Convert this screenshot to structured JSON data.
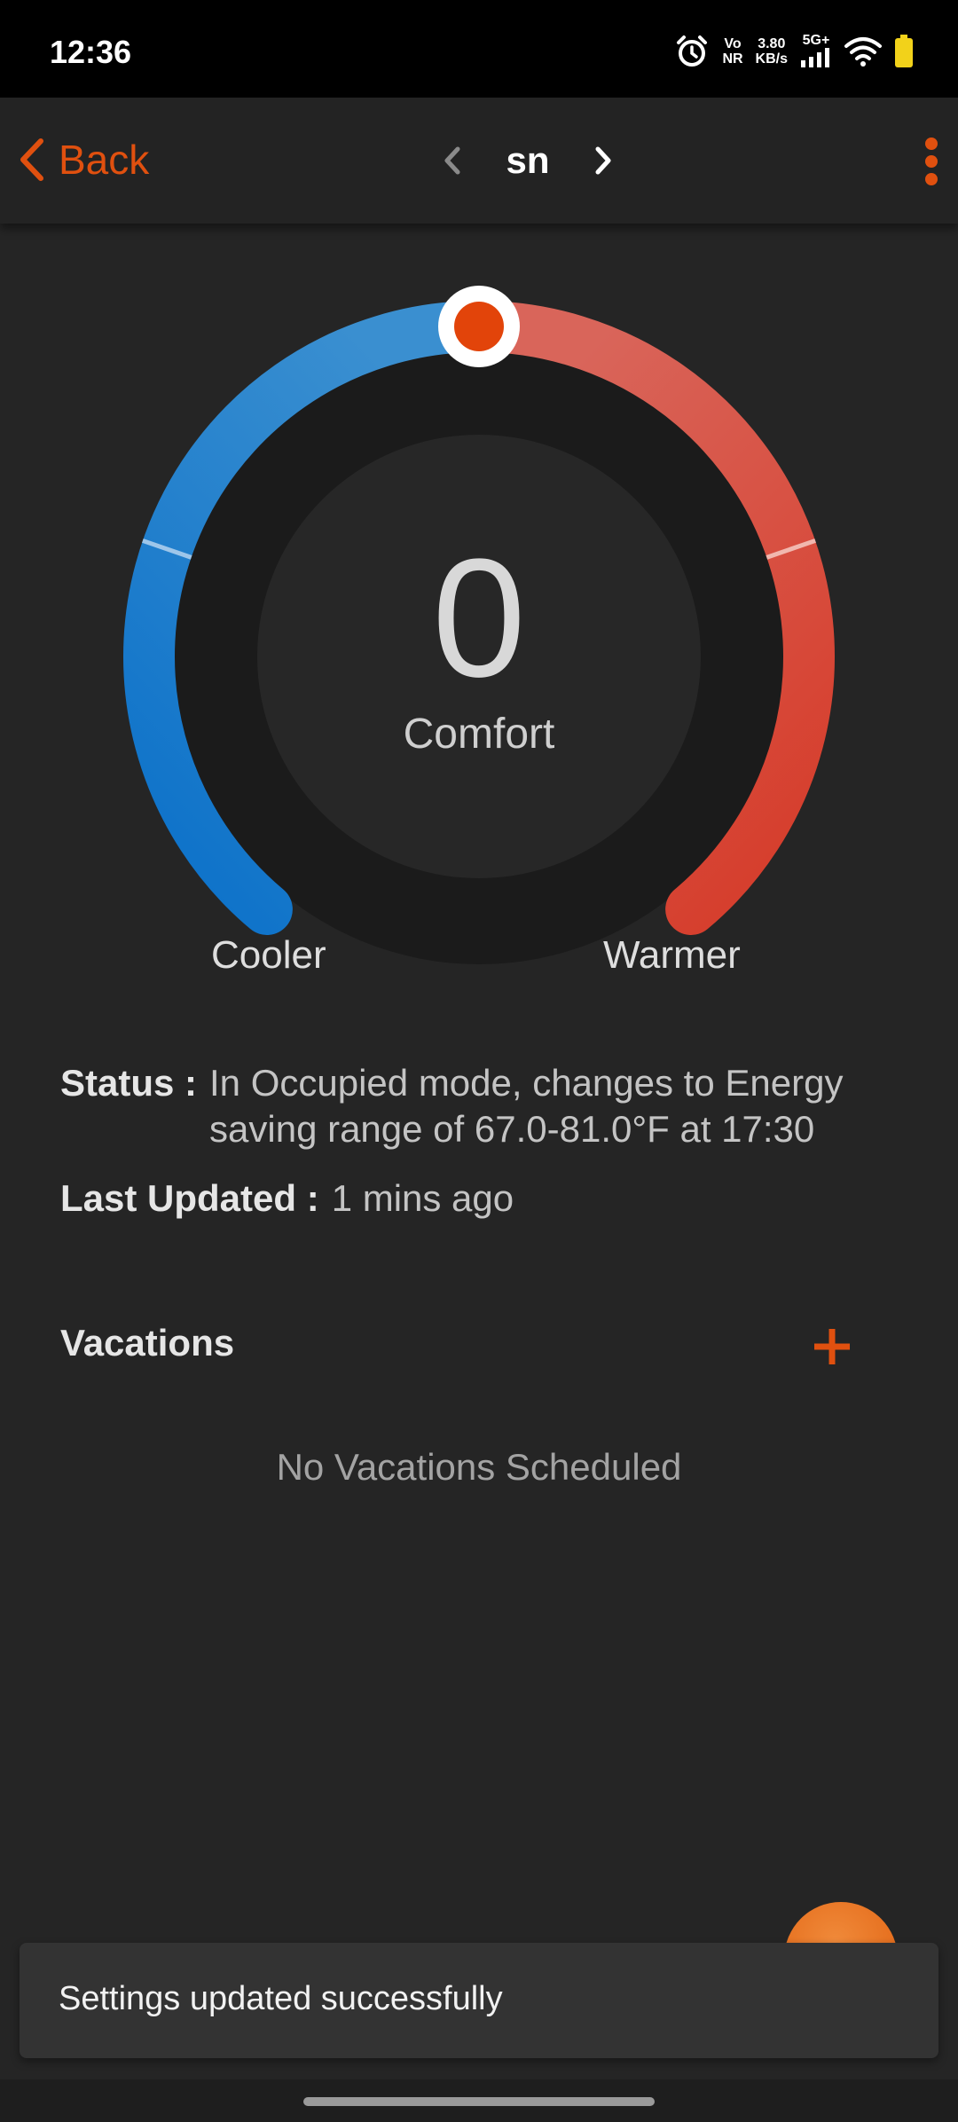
{
  "status_bar": {
    "time": "12:36",
    "volte_top": "Vo",
    "volte_bottom": "NR",
    "net_speed_value": "3.80",
    "net_speed_unit": "KB/s",
    "network_type": "5G+",
    "icons": [
      "alarm-icon",
      "signal-icon",
      "wifi-icon",
      "battery-icon"
    ]
  },
  "header": {
    "back_label": "Back",
    "device_name": "sn"
  },
  "dial": {
    "value": "0",
    "mode_label": "Comfort",
    "cooler_label": "Cooler",
    "warmer_label": "Warmer",
    "knob_fraction": 0.5,
    "colors": {
      "cool_start": "#0a70c9",
      "cool_end": "#3a8fd0",
      "warm_start": "#d9655a",
      "warm_end": "#d63a28",
      "knob": "#e2440a",
      "track": "#1b1b1b",
      "inner": "#272727"
    }
  },
  "status": {
    "status_key": "Status :",
    "status_value": "In Occupied mode, changes to Energy saving range of 67.0-81.0°F at 17:30",
    "updated_key": "Last Updated :",
    "updated_value": "1 mins ago"
  },
  "vacations": {
    "title": "Vacations",
    "empty_text": "No Vacations Scheduled"
  },
  "snackbar": {
    "message": "Settings updated successfully"
  },
  "colors": {
    "accent": "#e0500f",
    "background": "#252525"
  }
}
